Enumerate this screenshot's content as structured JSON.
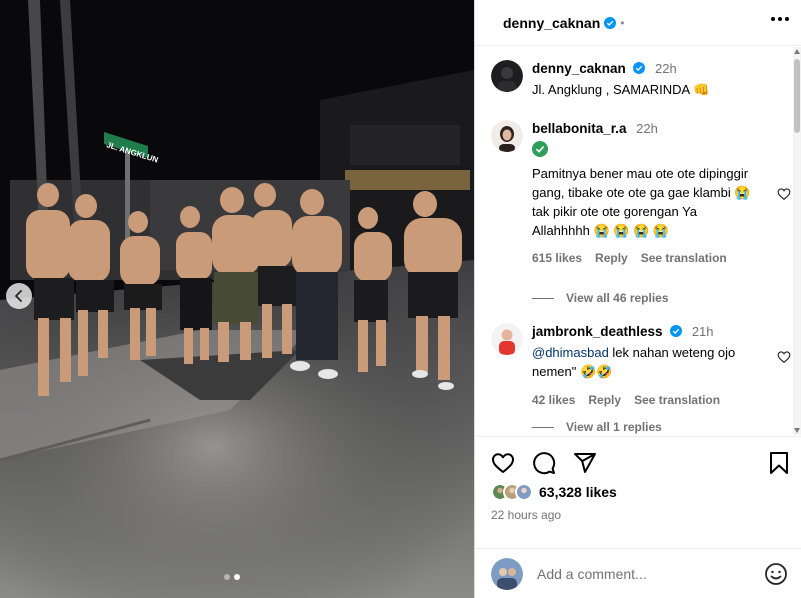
{
  "post": {
    "author": "denny_caknan",
    "header_dot": "•",
    "caption": {
      "user": "denny_caknan",
      "time": "22h",
      "text": "Jl. Angklung , SAMARINDA 👊"
    },
    "photo": {
      "street_sign_text": "JL. ANGKLUN",
      "carousel_count": 2,
      "carousel_active": 2
    }
  },
  "comments": [
    {
      "user": "bellabonita_r.a",
      "time": "22h",
      "text": "Pamitnya bener mau ote ote dipinggir gang, tibake ote ote ga gae klambi 😭 tak pikir ote ote gorengan Ya Allahhhhh 😭 😭 😭 😭",
      "likes": "615 likes",
      "reply": "Reply",
      "translate": "See translation",
      "view_replies": "View all 46 replies"
    },
    {
      "user": "jambronk_deathless",
      "time": "21h",
      "mention": "@dhimasbad",
      "text": " lek nahan weteng ojo nemen\" 🤣🤣",
      "likes": "42 likes",
      "reply": "Reply",
      "translate": "See translation",
      "view_replies": "View all 1 replies"
    }
  ],
  "footer": {
    "likes_count": "63,328 likes",
    "posted_ago": "22 hours ago",
    "comment_placeholder": "Add a comment..."
  },
  "icons": {
    "verified": "verified-badge-icon",
    "like": "heart-icon",
    "comment": "comment-bubble-icon",
    "share": "paper-plane-icon",
    "save": "bookmark-icon",
    "emoji": "smiley-icon",
    "more": "more-options-icon",
    "prev": "chevron-left-icon"
  },
  "colors": {
    "verified_blue": "#0095f6",
    "muted_text": "#737373",
    "mention_link": "#00376b",
    "divider": "#efefef"
  }
}
